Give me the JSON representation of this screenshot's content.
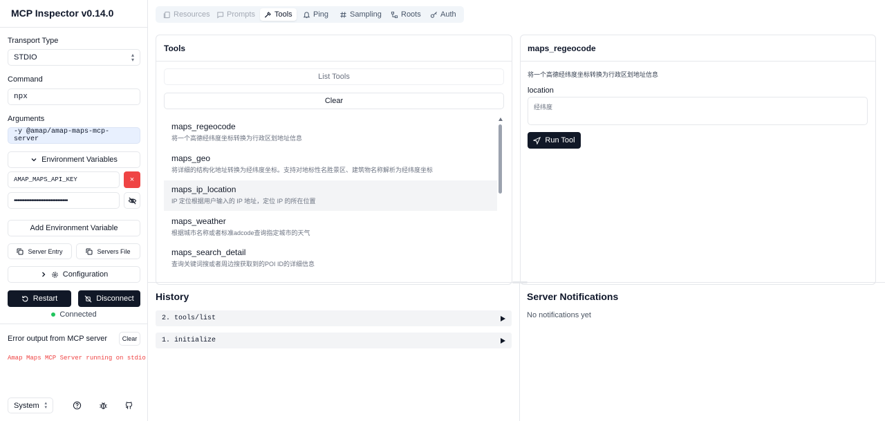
{
  "app": {
    "title": "MCP Inspector v0.14.0"
  },
  "sidebar": {
    "transport_label": "Transport Type",
    "transport_value": "STDIO",
    "command_label": "Command",
    "command_value": "npx",
    "arguments_label": "Arguments",
    "arguments_value": "-y @amap/amap-maps-mcp-server",
    "env_toggle_label": "Environment Variables",
    "env_key": "AMAP_MAPS_API_KEY",
    "env_value_masked": "•••••••••••••••••••••••••••••••",
    "env_remove_label": "×",
    "add_env_label": "Add Environment Variable",
    "server_entry_label": "Server Entry",
    "servers_file_label": "Servers File",
    "configuration_label": "Configuration",
    "restart_label": "Restart",
    "disconnect_label": "Disconnect",
    "status_text": "Connected",
    "error_title": "Error output from MCP server",
    "error_clear_label": "Clear",
    "error_text": "Amap Maps MCP Server running on stdio",
    "theme_value": "System",
    "colors": {
      "connected": "#22c55e",
      "error_text": "#ef4444",
      "danger": "#ef4444",
      "dark": "#111827"
    }
  },
  "tabs": [
    {
      "label": "Resources",
      "icon": "resources-icon",
      "state": "disabled"
    },
    {
      "label": "Prompts",
      "icon": "prompts-icon",
      "state": "disabled"
    },
    {
      "label": "Tools",
      "icon": "hammer-icon",
      "state": "active"
    },
    {
      "label": "Ping",
      "icon": "bell-icon",
      "state": "normal"
    },
    {
      "label": "Sampling",
      "icon": "hash-icon",
      "state": "normal"
    },
    {
      "label": "Roots",
      "icon": "roots-icon",
      "state": "normal"
    },
    {
      "label": "Auth",
      "icon": "key-icon",
      "state": "normal"
    }
  ],
  "tools_panel": {
    "title": "Tools",
    "list_button": "List Tools",
    "clear_button": "Clear",
    "items": [
      {
        "name": "maps_regeocode",
        "desc": "将一个高德经纬度坐标转换为行政区划地址信息"
      },
      {
        "name": "maps_geo",
        "desc": "将详细的结构化地址转换为经纬度坐标。支持对地标性名胜景区、建筑物名称解析为经纬度坐标"
      },
      {
        "name": "maps_ip_location",
        "desc": "IP 定位根据用户输入的 IP 地址，定位 IP 的所在位置"
      },
      {
        "name": "maps_weather",
        "desc": "根据城市名称或者标准adcode查询指定城市的天气"
      },
      {
        "name": "maps_search_detail",
        "desc": "查询关键词搜或者周边搜获取到的POI ID的详细信息"
      }
    ]
  },
  "detail_panel": {
    "title": "maps_regeocode",
    "description": "将一个高德经纬度坐标转换为行政区划地址信息",
    "param_label": "location",
    "param_placeholder": "经纬度",
    "run_button": "Run Tool"
  },
  "history": {
    "title": "History",
    "items": [
      {
        "label": "2. tools/list"
      },
      {
        "label": "1. initialize"
      }
    ]
  },
  "notifications": {
    "title": "Server Notifications",
    "empty_text": "No notifications yet"
  }
}
